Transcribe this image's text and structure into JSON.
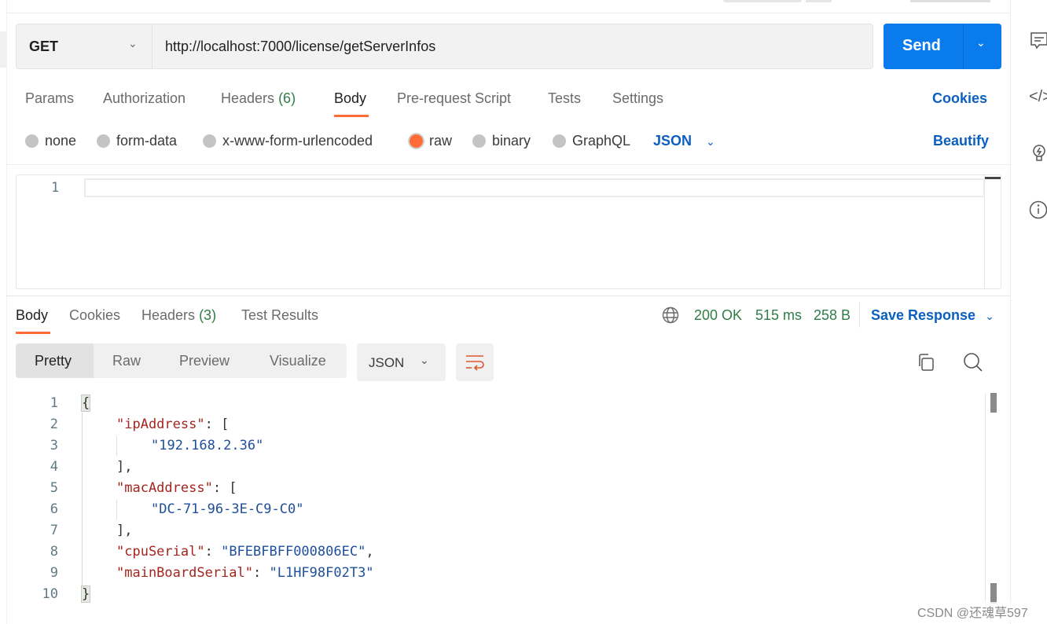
{
  "request": {
    "method": "GET",
    "url": "http://localhost:7000/license/getServerInfos",
    "send_label": "Send"
  },
  "req_tabs": [
    {
      "label": "Params"
    },
    {
      "label": "Authorization"
    },
    {
      "label": "Headers",
      "count": "(6)"
    },
    {
      "label": "Body",
      "active": true
    },
    {
      "label": "Pre-request Script"
    },
    {
      "label": "Tests"
    },
    {
      "label": "Settings"
    }
  ],
  "cookies_label": "Cookies",
  "body_types": [
    {
      "label": "none"
    },
    {
      "label": "form-data"
    },
    {
      "label": "x-www-form-urlencoded"
    },
    {
      "label": "raw",
      "selected": true
    },
    {
      "label": "binary"
    },
    {
      "label": "GraphQL"
    }
  ],
  "body_format": "JSON",
  "beautify_label": "Beautify",
  "request_editor": {
    "line_numbers": [
      "1"
    ]
  },
  "resp_tabs": [
    {
      "label": "Body",
      "active": true
    },
    {
      "label": "Cookies"
    },
    {
      "label": "Headers",
      "count": "(3)"
    },
    {
      "label": "Test Results"
    }
  ],
  "status": {
    "code": "200 OK",
    "time": "515 ms",
    "size": "258 B"
  },
  "save_response_label": "Save Response",
  "view_modes": [
    {
      "label": "Pretty",
      "active": true
    },
    {
      "label": "Raw"
    },
    {
      "label": "Preview"
    },
    {
      "label": "Visualize"
    }
  ],
  "response_format": "JSON",
  "response_lines": [
    "1",
    "2",
    "3",
    "4",
    "5",
    "6",
    "7",
    "8",
    "9",
    "10"
  ],
  "response_code": {
    "l1": "{",
    "l2_key": "\"ipAddress\"",
    "l2_rest": ": [",
    "l3": "\"192.168.2.36\"",
    "l4": "],",
    "l5_key": "\"macAddress\"",
    "l5_rest": ": [",
    "l6": "\"DC-71-96-3E-C9-C0\"",
    "l7": "],",
    "l8_key": "\"cpuSerial\"",
    "l8_sep": ": ",
    "l8_val": "\"BFEBFBFF000806EC\"",
    "l8_end": ",",
    "l9_key": "\"mainBoardSerial\"",
    "l9_sep": ": ",
    "l9_val": "\"L1HF98F02T3\"",
    "l10": "}"
  },
  "watermark": "CSDN @还魂草597",
  "colors": {
    "accent": "#ff6c37",
    "send": "#097bed",
    "link": "#0b5fbf",
    "status": "#2e7d45"
  }
}
